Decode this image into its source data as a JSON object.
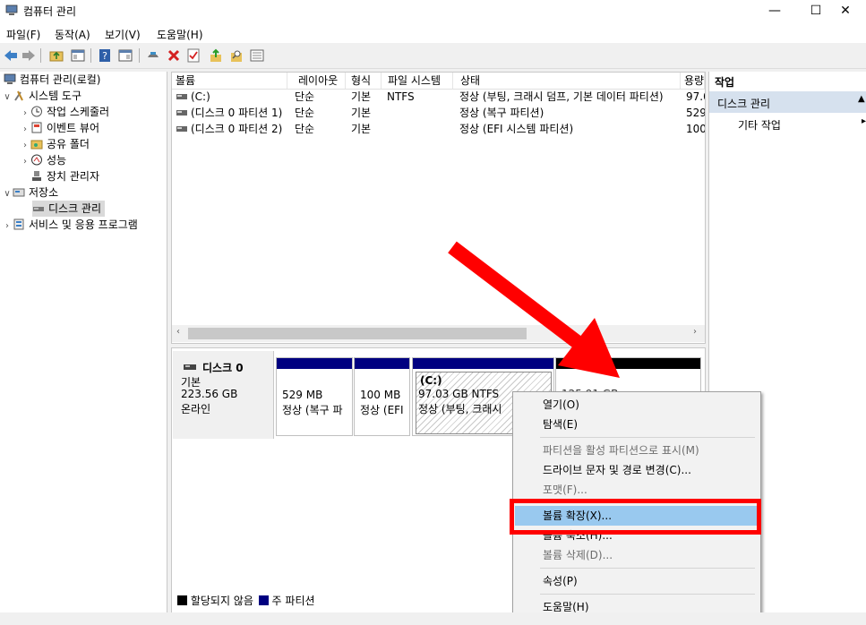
{
  "window": {
    "title": "컴퓨터 관리",
    "minimize": "—",
    "maximize": "☐",
    "close": "✕"
  },
  "menu": [
    "파일(F)",
    "동작(A)",
    "보기(V)",
    "도움말(H)"
  ],
  "tree": {
    "root": "컴퓨터 관리(로컬)",
    "system_tools": "시스템 도구",
    "task_scheduler": "작업 스케줄러",
    "event_viewer": "이벤트 뷰어",
    "shared_folders": "공유 폴더",
    "performance": "성능",
    "device_manager": "장치 관리자",
    "storage": "저장소",
    "disk_management": "디스크 관리",
    "services": "서비스 및 응용 프로그램"
  },
  "volume_list": {
    "columns": [
      "볼륨",
      "레이아웃",
      "형식",
      "파일 시스템",
      "상태",
      "용량"
    ],
    "rows": [
      [
        "(C:)",
        "단순",
        "기본",
        "NTFS",
        "정상 (부팅, 크래시 덤프, 기본 데이터 파티션)",
        "97.0"
      ],
      [
        "(디스크 0 파티션 1)",
        "단순",
        "기본",
        "",
        "정상 (복구 파티션)",
        "529"
      ],
      [
        "(디스크 0 파티션 2)",
        "단순",
        "기본",
        "",
        "정상 (EFI 시스템 파티션)",
        "100"
      ]
    ]
  },
  "disk": {
    "name": "디스크 0",
    "type": "기본",
    "size": "223.56 GB",
    "status": "온라인",
    "partitions": [
      {
        "size": "529 MB",
        "desc": "정상 (복구 파"
      },
      {
        "size": "100 MB",
        "desc": "정상 (EFI"
      },
      {
        "label": "(C:)",
        "size": "97.03 GB NTFS",
        "desc": "정상 (부팅, 크래시"
      },
      {
        "size": "125.91 GB"
      }
    ]
  },
  "legend": {
    "unallocated": "할당되지 않음",
    "primary": "주 파티션"
  },
  "actions": {
    "header": "작업",
    "disk_management": "디스크 관리",
    "more": "기타 작업"
  },
  "context_menu": {
    "open": "열기(O)",
    "explore": "탐색(E)",
    "mark_active": "파티션을 활성 파티션으로 표시(M)",
    "change_letter": "드라이브 문자 및 경로 변경(C)...",
    "format": "포맷(F)...",
    "extend": "볼륨 확장(X)...",
    "shrink": "볼륨 축소(H)...",
    "delete": "볼륨 삭제(D)...",
    "properties": "속성(P)",
    "help": "도움말(H)"
  },
  "colors": {
    "primary_partition": "#000080",
    "unallocated": "#000000",
    "highlight": "#99c9ef",
    "annotation": "#ff0000"
  }
}
